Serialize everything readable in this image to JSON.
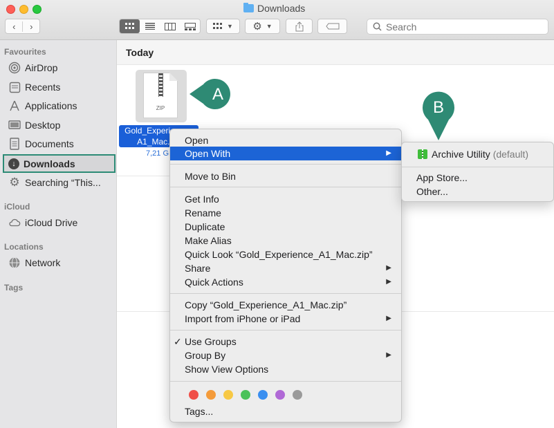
{
  "window": {
    "title": "Downloads",
    "toolbar": {
      "back": "‹",
      "forward": "›",
      "search_placeholder": "Search"
    }
  },
  "sidebar": {
    "favourites_heading": "Favourites",
    "favourites": [
      {
        "label": "AirDrop",
        "icon": "airdrop-icon"
      },
      {
        "label": "Recents",
        "icon": "clock-icon"
      },
      {
        "label": "Applications",
        "icon": "applications-icon"
      },
      {
        "label": "Desktop",
        "icon": "desktop-icon"
      },
      {
        "label": "Documents",
        "icon": "document-icon"
      },
      {
        "label": "Downloads",
        "icon": "download-icon"
      },
      {
        "label": "Searching “This...",
        "icon": "gear-icon"
      }
    ],
    "icloud_heading": "iCloud",
    "icloud_drive": "iCloud Drive",
    "locations_heading": "Locations",
    "network": "Network",
    "tags_heading": "Tags"
  },
  "main": {
    "section": "Today",
    "file": {
      "name_line1": "Gold_Experience_",
      "name_line2": "A1_Mac.zip",
      "icon_label": "ZIP",
      "size": "7,21 GB"
    }
  },
  "context_menu": {
    "open": "Open",
    "open_with": "Open With",
    "move_to_bin": "Move to Bin",
    "get_info": "Get Info",
    "rename": "Rename",
    "duplicate": "Duplicate",
    "make_alias": "Make Alias",
    "quick_look": "Quick Look “Gold_Experience_A1_Mac.zip”",
    "share": "Share",
    "quick_actions": "Quick Actions",
    "copy": "Copy “Gold_Experience_A1_Mac.zip”",
    "import": "Import from iPhone or iPad",
    "use_groups": "Use Groups",
    "group_by": "Group By",
    "show_view_options": "Show View Options",
    "tags": "Tags...",
    "tag_colors": [
      "#f04f48",
      "#f49b3a",
      "#f7c844",
      "#4bc25a",
      "#3a8ff0",
      "#b069d6",
      "#9a9a9a"
    ]
  },
  "submenu": {
    "archive_utility": "Archive Utility",
    "default_suffix": "(default)",
    "app_store": "App Store...",
    "other": "Other..."
  },
  "annotations": {
    "a": "A",
    "b": "B",
    "color": "#2e8a74",
    "highlight": "#2c8b75"
  }
}
